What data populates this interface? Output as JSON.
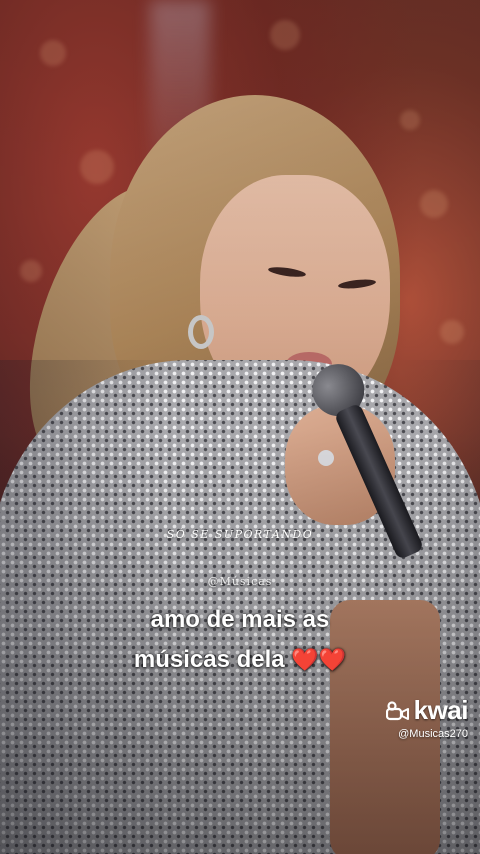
{
  "overlay": {
    "song_text": "SÓ SE SUPORTANDO",
    "handle_text": "@Músicas",
    "caption_line1": "amo de mais as",
    "caption_line2": "músicas dela",
    "caption_emoji": "❤️❤️"
  },
  "watermark": {
    "brand": "kwai",
    "username": "@Musicas270",
    "icon": "kwai-logo-icon"
  },
  "colors": {
    "heart": "#e0202c",
    "text": "#ffffff"
  }
}
